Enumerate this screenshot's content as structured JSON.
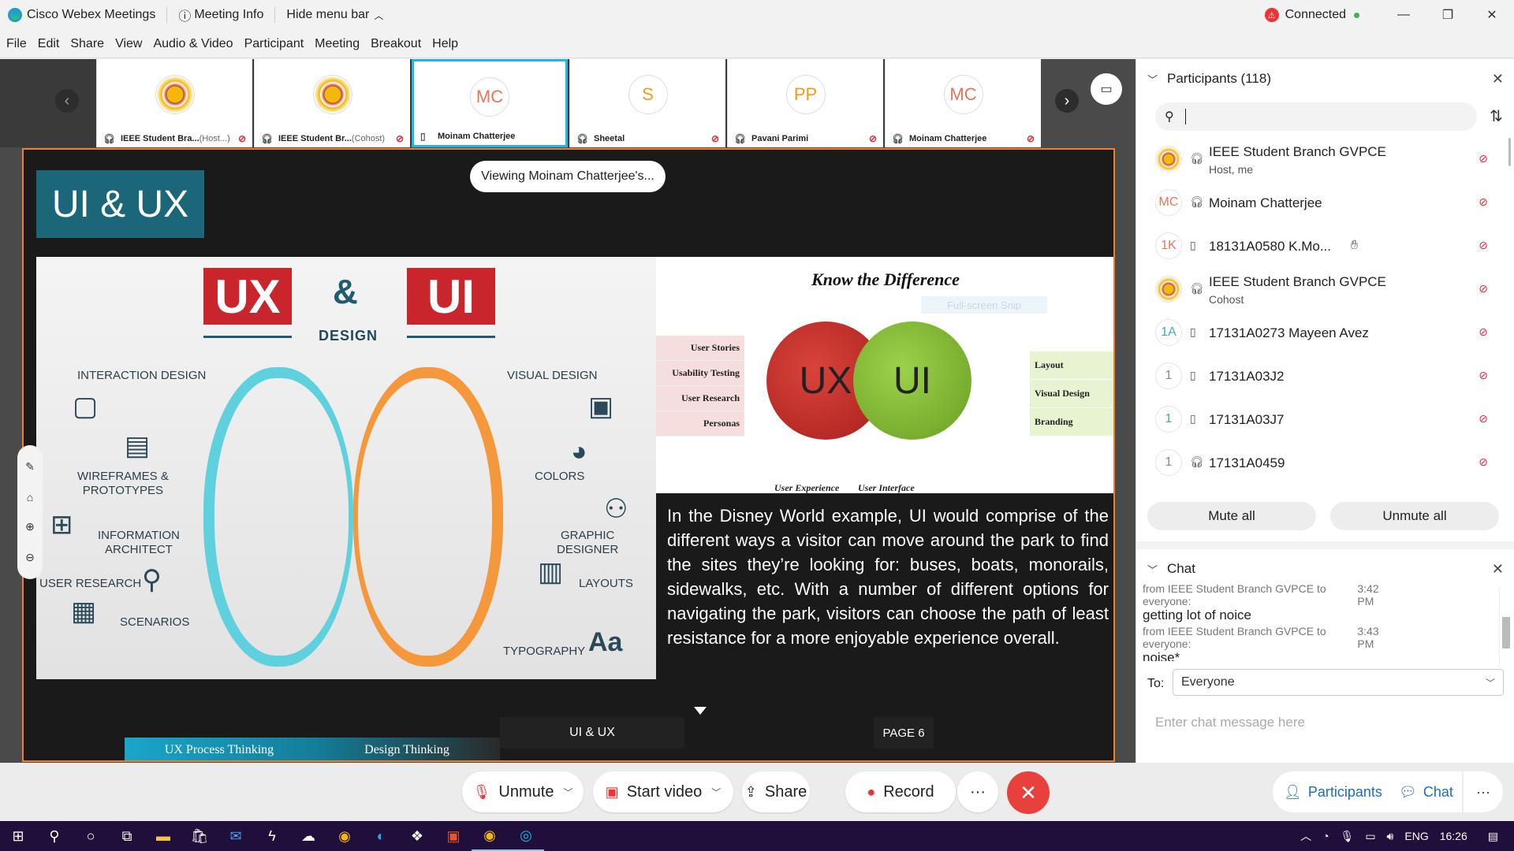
{
  "titlebar": {
    "app_name": "Cisco Webex Meetings",
    "meeting_info": "Meeting Info",
    "hide_menu": "Hide menu bar",
    "connection": "Connected"
  },
  "menu": [
    "File",
    "Edit",
    "Share",
    "View",
    "Audio & Video",
    "Participant",
    "Meeting",
    "Breakout",
    "Help"
  ],
  "filmstrip": [
    {
      "initials": "",
      "name": "IEEE Student Bra...",
      "role": "(Host...)"
    },
    {
      "initials": "",
      "name": "IEEE Student Br...",
      "role": "(Cohost)"
    },
    {
      "initials": "MC",
      "name": "Moinam Chatterjee",
      "role": ""
    },
    {
      "initials": "S",
      "name": "Sheetal",
      "role": ""
    },
    {
      "initials": "PP",
      "name": "Pavani Parimi",
      "role": ""
    },
    {
      "initials": "MC",
      "name": "Moinam Chatterjee",
      "role": ""
    }
  ],
  "slide": {
    "title": "UI & UX",
    "viewing": "Viewing Moinam Chatterjee's...",
    "ux": "UX",
    "amp": "&",
    "ui": "UI",
    "design": "DESIGN",
    "labels": {
      "interaction": "INTERACTION DESIGN",
      "visual": "VISUAL DESIGN",
      "wireframes": "WIREFRAMES &\nPROTOTYPES",
      "colors": "COLORS",
      "info": "INFORMATION\nARCHITECT",
      "graphic": "GRAPHIC\nDESIGNER",
      "research": "USER RESEARCH",
      "layouts": "LAYOUTS",
      "scenarios": "SCENARIOS",
      "typography": "TYPOGRAPHY",
      "aa": "Aa"
    },
    "know": "Know the Difference",
    "snip": "Full-screen Snip",
    "left_table": [
      "User Stories",
      "Usability Testing",
      "User Research",
      "Personas"
    ],
    "right_table": [
      "Layout",
      "Visual Design",
      "Branding"
    ],
    "circle_ux": "UX",
    "circle_ui": "UI",
    "ux_sub": "User Experience",
    "ui_sub": "User Interface",
    "paragraph": "In the Disney World example, UI would comprise of the different ways a visitor can move around the park to find the sites they’re looking for: buses, boats, monorails, sidewalks, etc. With a number of different options for navigating the park, visitors can choose the path of least resistance for a more enjoyable experience overall.",
    "footer_1": "UX Process Thinking",
    "footer_2": "Design Thinking",
    "footer_3": "UI & UX",
    "page": "PAGE 6"
  },
  "participants": {
    "header": "Participants (118)",
    "list": [
      {
        "avatar": "",
        "name": "IEEE Student Branch GVPCE",
        "sub": "Host, me",
        "icon": "headset"
      },
      {
        "avatar": "MC",
        "name": "Moinam Chatterjee",
        "sub": "",
        "icon": "headset"
      },
      {
        "avatar": "1K",
        "name": "18131A0580 K.Mo...",
        "sub": "",
        "icon": "phone"
      },
      {
        "avatar": "",
        "name": "IEEE Student Branch GVPCE",
        "sub": "Cohost",
        "icon": "headset"
      },
      {
        "avatar": "1A",
        "name": "17131A0273 Mayeen Avez",
        "sub": "",
        "icon": "phone"
      },
      {
        "avatar": "1",
        "name": "17131A03J2",
        "sub": "",
        "icon": "phone"
      },
      {
        "avatar": "1",
        "name": "17131A03J7",
        "sub": "",
        "icon": "phone"
      },
      {
        "avatar": "1",
        "name": "17131A0459",
        "sub": "",
        "icon": "headset"
      }
    ],
    "mute_all": "Mute all",
    "unmute_all": "Unmute all"
  },
  "chat": {
    "header": "Chat",
    "messages": [
      {
        "from": "from IEEE Student Branch GVPCE to everyone:",
        "time": "3:42 PM",
        "text": "getting lot of noice"
      },
      {
        "from": "from IEEE Student Branch GVPCE to everyone:",
        "time": "3:43 PM",
        "text": "noise*"
      }
    ],
    "to_label": "To:",
    "to_value": "Everyone",
    "placeholder": "Enter chat message here"
  },
  "controls": {
    "unmute": "Unmute",
    "start_video": "Start video",
    "share": "Share",
    "record": "Record",
    "more": "···",
    "participants": "Participants",
    "chat": "Chat"
  },
  "taskbar": {
    "lang": "ENG",
    "time": "16:26"
  },
  "colors": {
    "accent": "#1ab7e8",
    "end": "#e8403d",
    "slide_border": "#f07f2d",
    "taskbar": "#1f0f3a"
  }
}
